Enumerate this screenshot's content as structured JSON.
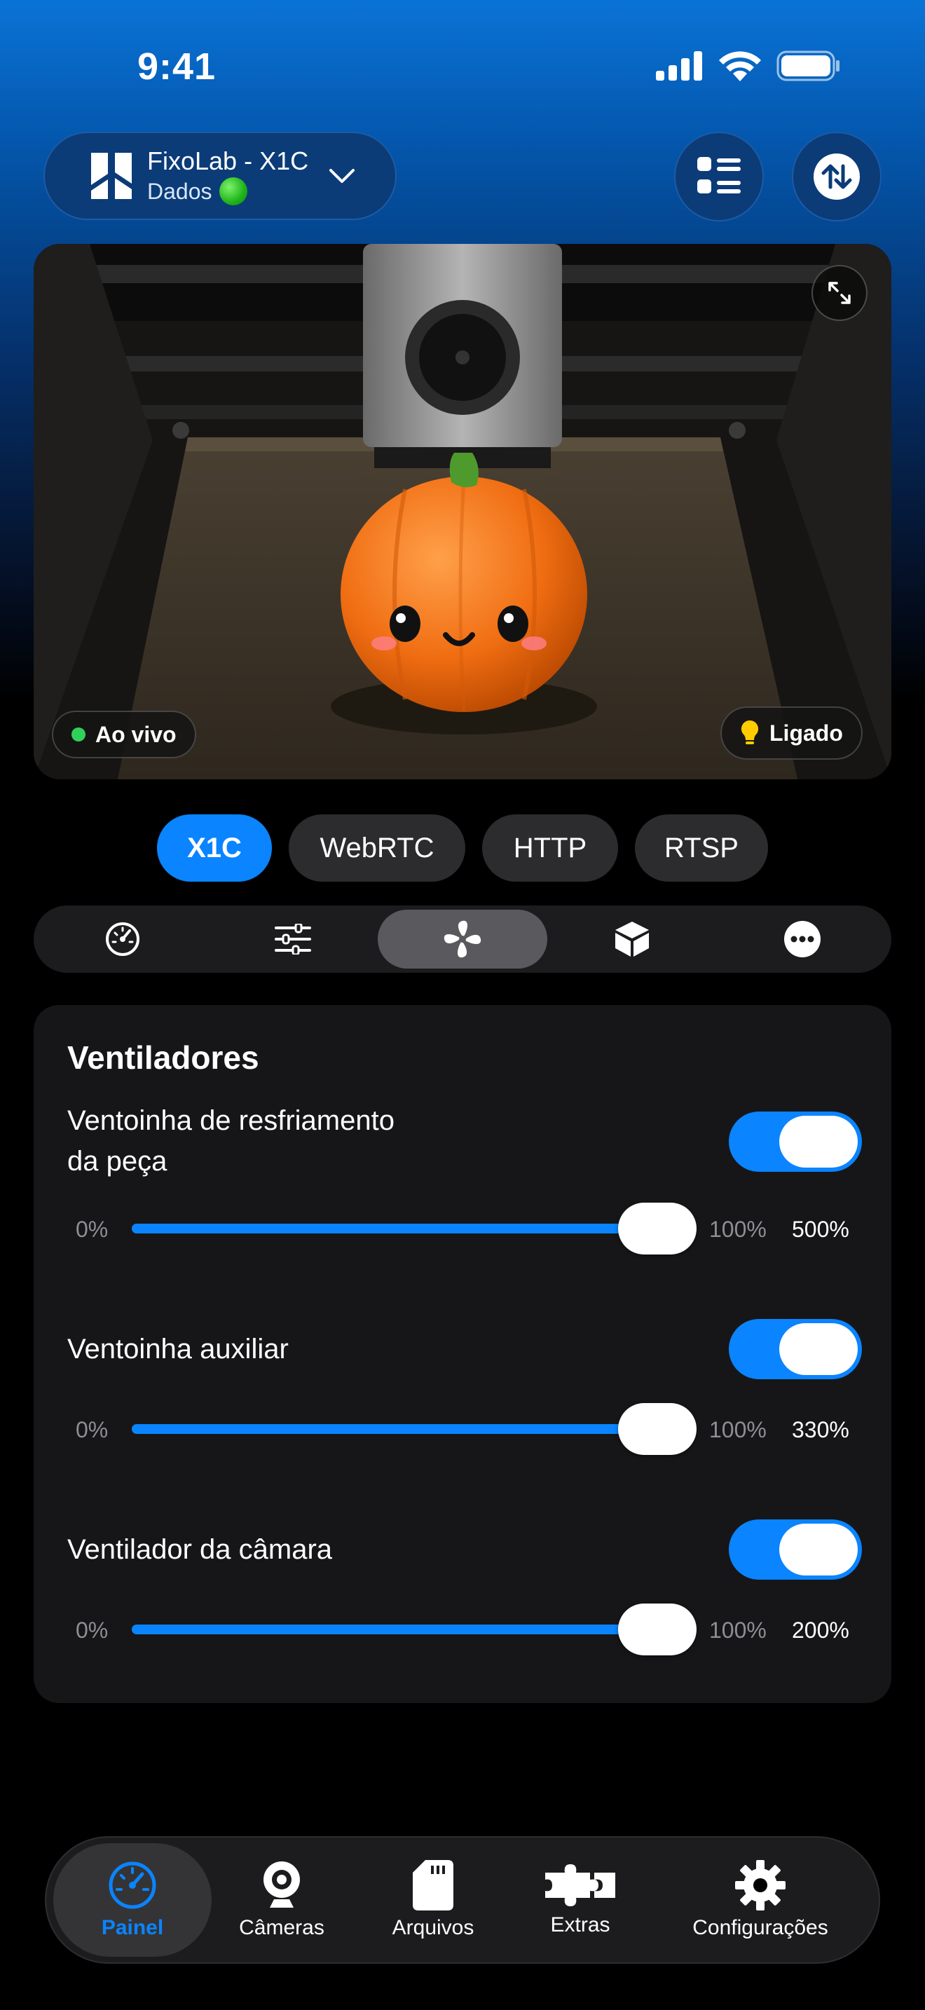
{
  "status_bar": {
    "time": "9:41"
  },
  "printer": {
    "name": "FixoLab - X1C",
    "subtitle": "Dados"
  },
  "camera": {
    "live_label": "Ao vivo",
    "light_label": "Ligado"
  },
  "sources": [
    {
      "label": "X1C",
      "active": true
    },
    {
      "label": "WebRTC",
      "active": false
    },
    {
      "label": "HTTP",
      "active": false
    },
    {
      "label": "RTSP",
      "active": false
    }
  ],
  "segments": [
    "dashboard-icon",
    "sliders-icon",
    "fan-icon",
    "box-icon",
    "more-icon"
  ],
  "fans": {
    "title": "Ventiladores",
    "items": [
      {
        "label_line1": "Ventoinha de resfriamento",
        "label_line2": "da peça",
        "enabled": true,
        "min": "0%",
        "max": "100%",
        "value": "500%"
      },
      {
        "label_line1": "Ventoinha auxiliar",
        "label_line2": "",
        "enabled": true,
        "min": "0%",
        "max": "100%",
        "value": "330%"
      },
      {
        "label_line1": "Ventilador da câmara",
        "label_line2": "",
        "enabled": true,
        "min": "0%",
        "max": "100%",
        "value": "200%"
      }
    ]
  },
  "tabs": [
    {
      "label": "Painel",
      "icon": "gauge-icon",
      "active": true
    },
    {
      "label": "Câmeras",
      "icon": "webcam-icon",
      "active": false
    },
    {
      "label": "Arquivos",
      "icon": "sd-card-icon",
      "active": false
    },
    {
      "label": "Extras",
      "icon": "puzzle-icon",
      "active": false
    },
    {
      "label": "Configurações",
      "icon": "gear-icon",
      "active": false
    }
  ],
  "colors": {
    "accent": "#0a84ff",
    "status_green": "#30d158"
  }
}
